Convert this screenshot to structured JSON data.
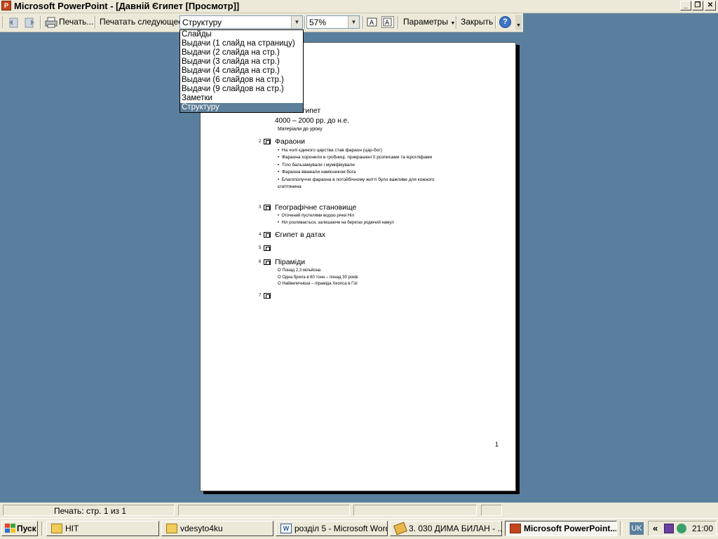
{
  "window": {
    "title": "Microsoft PowerPoint - [Давній Єгипет [Просмотр]]",
    "app_icon_letter": "P"
  },
  "toolbar": {
    "print_label": "Печать...",
    "print_what_label": "Печатать следующее:",
    "print_what_value": "Структуру",
    "zoom_value": "57%",
    "options_label": "Параметры",
    "close_label": "Закрыть",
    "help_glyph": "?"
  },
  "print_what_options": [
    "Слайды",
    "Выдачи (1 слайд на страницу)",
    "Выдачи (2 слайда на стр.)",
    "Выдачи (3 слайда на стр.)",
    "Выдачи (4 слайда на стр.)",
    "Выдачи (6 слайдов на стр.)",
    "Выдачи (9 слайдов на стр.)",
    "Заметки",
    "Структуру"
  ],
  "selected_option": "Структуру",
  "outline": {
    "slide1": {
      "title_visible": "Єгипет",
      "subtitle": "4000 – 2000 рр. до н.е.",
      "note": "Матеріали до уроку"
    },
    "slide2": {
      "num": "2",
      "title": "Фараони",
      "bullets": [
        "На чолі єдиного царства став фараон (цар-бог)",
        "Фараона хоронили в гробниці, прикрашені її розписами та ієрогліфами",
        "Тіло бальзамували і муміфікували",
        "Фараона вважали намісником бога",
        "Благополуччя фараона в потойбічному житті було важливе для кожного єгиптянина"
      ]
    },
    "slide3": {
      "num": "3",
      "title": "Географічне становище",
      "bullets": [
        "Оточений пустелями водою річки Ніл",
        "Ніл розливається, залишаючи на берегах родючий намул"
      ]
    },
    "slide4": {
      "num": "4",
      "title": "Єгипет в датах"
    },
    "slide5": {
      "num": "5"
    },
    "slide6": {
      "num": "6",
      "title": "Піраміди",
      "bullets": [
        "Понад 2,3 мільйона",
        "Одна брила в 60 тонн – понад 30 років",
        "Найвеличніша – піраміда Хеопса в Гізі"
      ]
    },
    "slide7": {
      "num": "7"
    },
    "page_number": "1"
  },
  "status": {
    "page_text": "Печать: стр. 1 из 1"
  },
  "taskbar": {
    "start_label": "Пуск",
    "tasks": [
      "HIT",
      "vdesyto4ku",
      "розділ 5 - Microsoft Word",
      "3. 030 ДИМА БИЛАН - ...",
      "Microsoft PowerPoint..."
    ],
    "language": "UK",
    "chevron": "«",
    "clock": "21:00"
  },
  "colors": {
    "desktop": "#5a7f9e",
    "selection": "#5e7f99",
    "chrome": "#ece9d8"
  }
}
